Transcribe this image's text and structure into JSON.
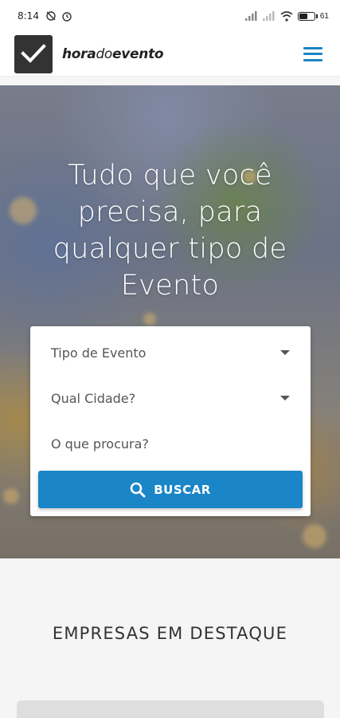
{
  "statusbar": {
    "time": "8:14",
    "battery": "61",
    "battery_level": 0.61
  },
  "header": {
    "brand_bold_1": "hora",
    "brand_light": "do",
    "brand_bold_2": "evento"
  },
  "hero": {
    "title": "Tudo que você precisa, para qualquer tipo de Evento"
  },
  "search": {
    "event_type": "Tipo de Evento",
    "city": "Qual Cidade?",
    "query_placeholder": "O que procura?",
    "button_label": "BUSCAR"
  },
  "featured": {
    "title": "EMPRESAS EM DESTAQUE"
  },
  "colors": {
    "accent": "#1a86c7",
    "logo_bg": "#333333"
  }
}
